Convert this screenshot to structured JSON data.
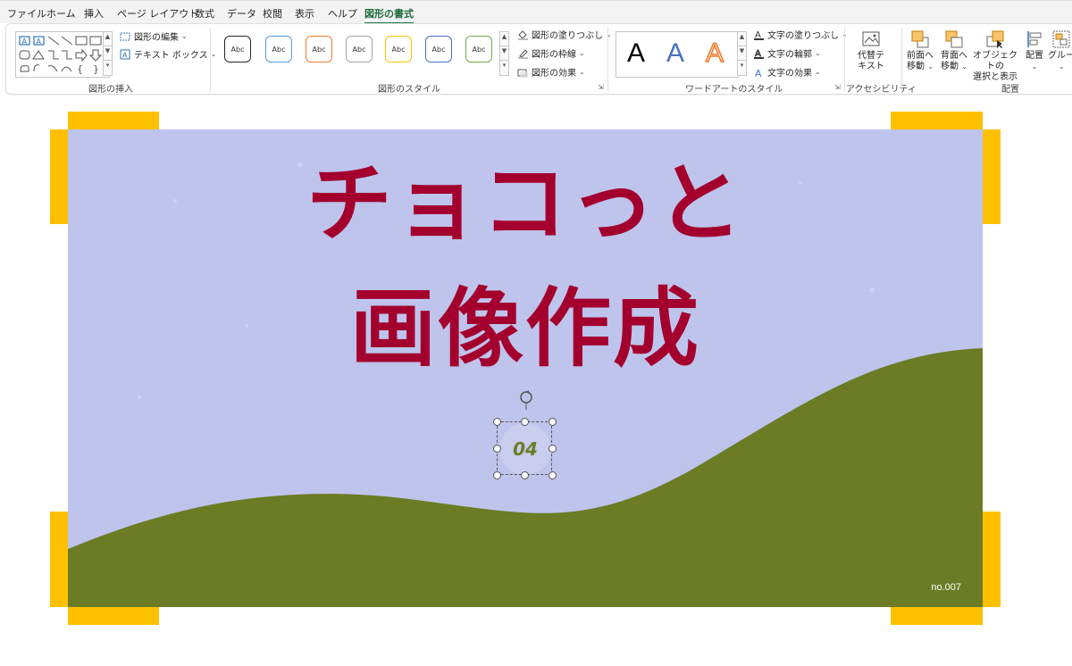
{
  "menu": {
    "tabs": [
      "ファイル",
      "ホーム",
      "挿入",
      "ページ レイアウト",
      "数式",
      "データ",
      "校閲",
      "表示",
      "ヘルプ",
      "図形の書式"
    ],
    "active_tab": "図形の書式"
  },
  "ribbon": {
    "insert_shapes": {
      "label": "図形の挿入",
      "edit_shape": "図形の編集",
      "text_box": "テキスト ボックス"
    },
    "shape_styles": {
      "label": "図形のスタイル",
      "preset_text": "Abc",
      "preset_colors": [
        "#262626",
        "#5b9bd5",
        "#ed7d31",
        "#a5a5a5",
        "#ffc000",
        "#4472c4",
        "#70ad47"
      ],
      "fill": "図形の塗りつぶし",
      "outline": "図形の枠線",
      "effects": "図形の効果"
    },
    "wordart": {
      "label": "ワードアートのスタイル",
      "sample": "A",
      "text_fill": "文字の塗りつぶし",
      "text_outline": "文字の輪郭",
      "text_effects": "文字の効果"
    },
    "accessibility": {
      "label": "アクセシビリティ",
      "alt_text_line1": "代替テ",
      "alt_text_line2": "キスト"
    },
    "arrange": {
      "label": "配置",
      "bring_forward_1": "前面へ",
      "bring_forward_2": "移動",
      "send_backward_1": "背面へ",
      "send_backward_2": "移動",
      "selection_pane_1": "オブジェクトの",
      "selection_pane_2": "選択と表示",
      "align": "配置",
      "group": "グループ"
    }
  },
  "slide": {
    "title_line1": "チョコっと",
    "title_line2": "画像作成",
    "badge_number": "04",
    "slide_number": "no.007",
    "colors": {
      "sky": "#bec4ec",
      "hill": "#6b7c25",
      "title": "#a3002e",
      "corner": "#ffc000"
    }
  }
}
